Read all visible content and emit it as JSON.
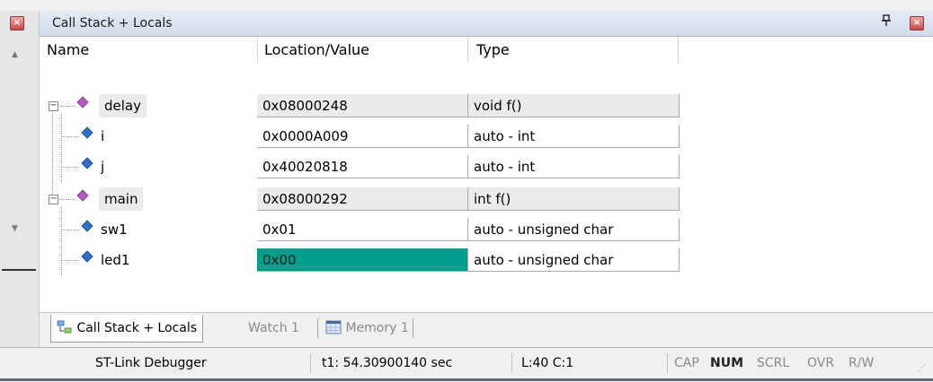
{
  "window": {
    "title": "Call Stack + Locals",
    "pin_glyph": "ª",
    "close_glyph": "×"
  },
  "columns": {
    "name": "Name",
    "location": "Location/Value",
    "type": "Type"
  },
  "rows": [
    {
      "name": "delay",
      "kind": "function",
      "value": "0x08000248",
      "type": "void f()",
      "expanded": true
    },
    {
      "name": "i",
      "kind": "local",
      "value": "0x0000A009",
      "type": "auto - int"
    },
    {
      "name": "j",
      "kind": "local",
      "value": "0x40020818",
      "type": "auto - int"
    },
    {
      "name": "main",
      "kind": "function",
      "value": "0x08000292",
      "type": "int f()",
      "expanded": true
    },
    {
      "name": "sw1",
      "kind": "local",
      "value": "0x01",
      "type": "auto - unsigned char"
    },
    {
      "name": "led1",
      "kind": "local",
      "value": "0x00",
      "type": "auto - unsigned char",
      "highlighted": true
    }
  ],
  "expander_glyph": "−",
  "tabs": [
    {
      "label": "Call Stack + Locals",
      "active": true
    },
    {
      "label": "Watch 1",
      "active": false
    },
    {
      "label": "Memory 1",
      "active": false
    }
  ],
  "status": {
    "debugger": "ST-Link Debugger",
    "time": "t1: 54.30900140 sec",
    "position": "L:40 C:1",
    "indicators": [
      "CAP",
      "NUM",
      "SCRL",
      "OVR",
      "R/W"
    ]
  },
  "colors": {
    "highlight": "#009e8c",
    "function_icon": "#b05cc0",
    "local_icon": "#2f6fd0"
  },
  "icons": {
    "function": "purple-diamond-icon",
    "local": "blue-diamond-icon",
    "call_stack_tab": "call-stack-icon",
    "memory_tab": "memory-grid-icon"
  }
}
